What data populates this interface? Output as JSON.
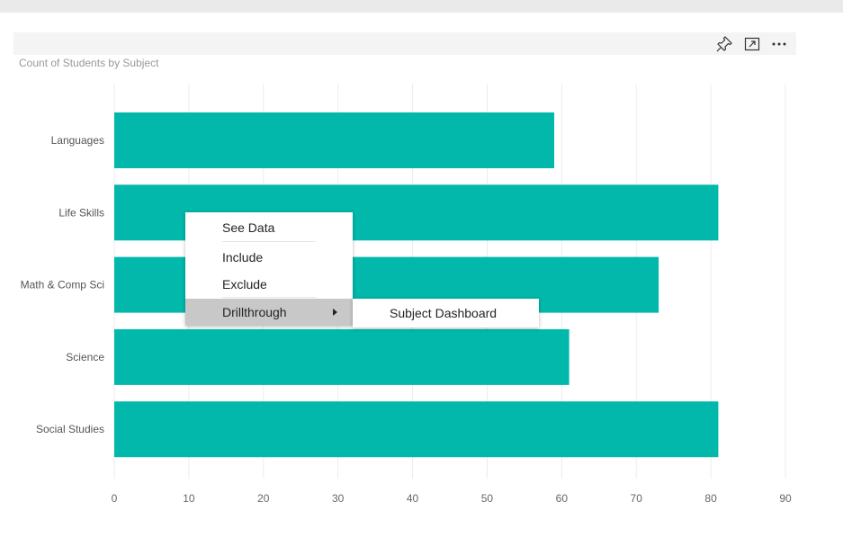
{
  "visual": {
    "title": "Count of Students by Subject",
    "header_icons": [
      "pin-icon",
      "focus-mode-icon",
      "more-options-icon"
    ]
  },
  "chart_data": {
    "type": "bar",
    "orientation": "horizontal",
    "title": "Count of Students by Subject",
    "categories": [
      "Languages",
      "Life Skills",
      "Math & Comp Sci",
      "Science",
      "Social Studies"
    ],
    "values": [
      59,
      81,
      73,
      61,
      81
    ],
    "xlim": [
      0,
      90
    ],
    "xticks": [
      0,
      10,
      20,
      30,
      40,
      50,
      60,
      70,
      80,
      90
    ],
    "grid": true,
    "color": "#01B8AA"
  },
  "context_menu": {
    "items": [
      {
        "label": "See Data"
      },
      {
        "label": "Include"
      },
      {
        "label": "Exclude"
      },
      {
        "label": "Drillthrough"
      }
    ],
    "submenu": {
      "label": "Subject Dashboard"
    }
  },
  "colors": {
    "bar": "#01B8AA",
    "menu_highlight": "#c8c8c8",
    "grid": "#ececec"
  }
}
